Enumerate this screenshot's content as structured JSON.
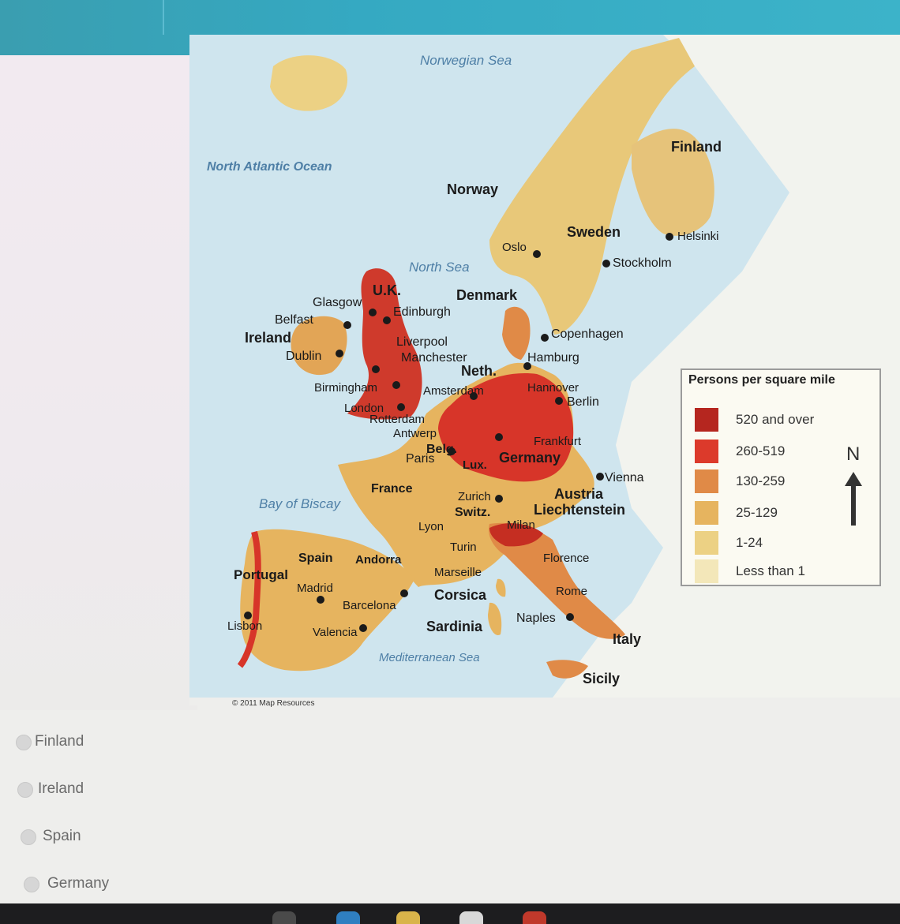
{
  "header": {
    "course": "",
    "title": "",
    "subtitle": ""
  },
  "map": {
    "credit": "© 2011 Map Resources",
    "water_labels": {
      "norwegian_sea": "Norwegian Sea",
      "north_atlantic": "North Atlantic Ocean",
      "north_sea": "North Sea",
      "bay_of_biscay": "Bay of Biscay",
      "mediterranean": "Mediterranean Sea"
    },
    "country_labels": {
      "finland": "Finland",
      "norway": "Norway",
      "sweden": "Sweden",
      "denmark": "Denmark",
      "uk": "U.K.",
      "ireland": "Ireland",
      "neth": "Neth.",
      "belg": "Belg.",
      "lux": "Lux.",
      "germany": "Germany",
      "france": "France",
      "switz": "Switz.",
      "austria": "Austria",
      "liechtenstein": "Liechtenstein",
      "spain": "Spain",
      "andorra": "Andorra",
      "portugal": "Portugal",
      "italy": "Italy",
      "corsica": "Corsica",
      "sardinia": "Sardinia",
      "sicily": "Sicily"
    },
    "city_labels": {
      "helsinki": "Helsinki",
      "oslo": "Oslo",
      "stockholm": "Stockholm",
      "copenhagen": "Copenhagen",
      "hamburg": "Hamburg",
      "hannover": "Hannover",
      "berlin": "Berlin",
      "glasgow": "Glasgow",
      "edinburgh": "Edinburgh",
      "belfast": "Belfast",
      "dublin": "Dublin",
      "liverpool": "Liverpool",
      "manchester": "Manchester",
      "birmingham": "Birmingham",
      "london": "London",
      "amsterdam": "Amsterdam",
      "rotterdam": "Rotterdam",
      "antwerp": "Antwerp",
      "frankfurt": "Frankfurt",
      "paris": "Paris",
      "zurich": "Zurich",
      "lyon": "Lyon",
      "turin": "Turin",
      "milan": "Milan",
      "vienna": "Vienna",
      "florence": "Florence",
      "rome": "Rome",
      "naples": "Naples",
      "marseille": "Marseille",
      "barcelona": "Barcelona",
      "madrid": "Madrid",
      "valencia": "Valencia",
      "lisbon": "Lisbon"
    },
    "legend": {
      "title": "Persons per square mile",
      "items": [
        {
          "label": "520 and over",
          "color": "#b5261f"
        },
        {
          "label": "260-519",
          "color": "#dc3a2b"
        },
        {
          "label": "130-259",
          "color": "#e08a47"
        },
        {
          "label": "25-129",
          "color": "#e6b45f"
        },
        {
          "label": "1-24",
          "color": "#ecd184"
        },
        {
          "label": "Less than 1",
          "color": "#f3e7b9"
        }
      ]
    },
    "compass": "N"
  },
  "choices": [
    {
      "label": "Finland"
    },
    {
      "label": "Ireland"
    },
    {
      "label": "Spain"
    },
    {
      "label": "Germany"
    }
  ],
  "colors": {
    "header": "#35a9c2",
    "water": "#cfe5ee",
    "land_other": "#f2f3ee"
  }
}
